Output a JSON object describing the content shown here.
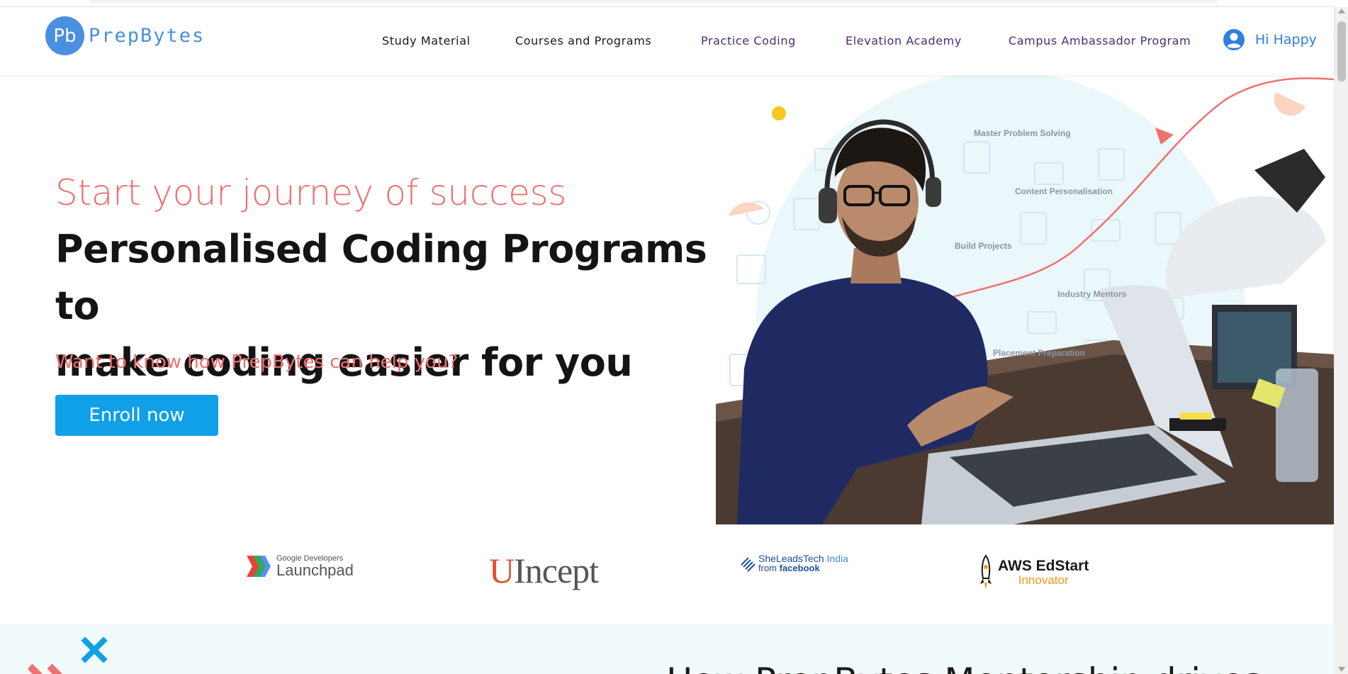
{
  "brand": {
    "logo_mark": "Pb",
    "name": "PrepBytes",
    "color": "#4a8fe0"
  },
  "nav": {
    "items": [
      {
        "label": "Study Material"
      },
      {
        "label": "Courses and Programs"
      },
      {
        "label": "Practice Coding"
      },
      {
        "label": "Elevation Academy"
      },
      {
        "label": "Campus Ambassador Program"
      }
    ],
    "user_label": "Hi Happy",
    "user_icon": "user-circle-icon"
  },
  "hero": {
    "subtitle": "Start your journey of success",
    "title_line1": "Personalised Coding Programs to",
    "title_line2": "make coding easier for you",
    "question": "Want to know how PrepBytes can help you?",
    "cta": "Enroll now",
    "accent": "#f07070",
    "cta_color": "#0fa0e8"
  },
  "features": [
    "Master Problem Solving",
    "Content Personalisation",
    "Build Projects",
    "Industry Mentors",
    "Placement Preparation"
  ],
  "partners": {
    "launchpad_small": "Google Developers",
    "launchpad_big": "Launchpad",
    "uincept_u": "U",
    "uincept_rest": "Incept",
    "she_leads": "SheLeadsTech",
    "she_india": " India",
    "she_from": "from ",
    "she_facebook": "facebook",
    "aws_title": "AWS EdStart",
    "aws_sub": "Innovator"
  },
  "bottom": {
    "heading": "How PrepBytes Mentorship drives"
  }
}
